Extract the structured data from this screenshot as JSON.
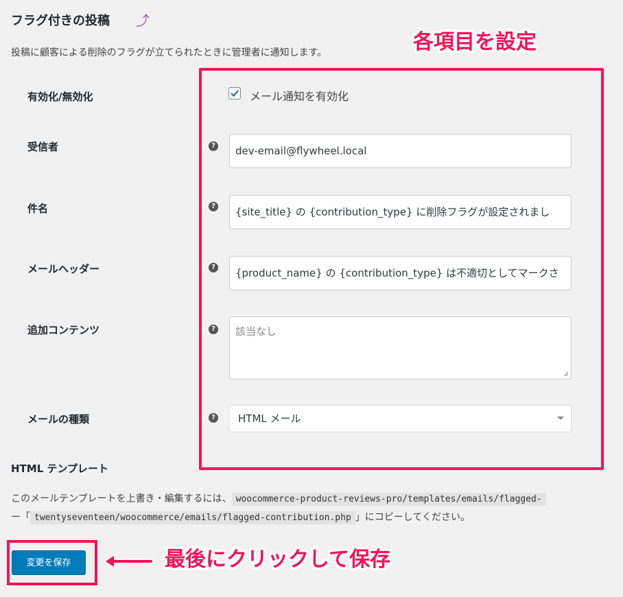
{
  "page": {
    "title": "フラグ付きの投稿",
    "back_link": "⤴",
    "description": "投稿に顧客による削除のフラグが立てられたときに管理者に通知します。"
  },
  "form": {
    "enable": {
      "label": "有効化/無効化",
      "checkbox_label": "メール通知を有効化",
      "checked": true
    },
    "recipient": {
      "label": "受信者",
      "value": "dev-email@flywheel.local"
    },
    "subject": {
      "label": "件名",
      "value": "{site_title} の {contribution_type} に削除フラグが設定されまし"
    },
    "header": {
      "label": "メールヘッダー",
      "value": "{product_name} の {contribution_type} は不適切としてマークさ"
    },
    "additional": {
      "label": "追加コンテンツ",
      "placeholder": "該当なし"
    },
    "email_type": {
      "label": "メールの種類",
      "selected": "HTML メール"
    },
    "help_icon": "?"
  },
  "template": {
    "heading": "HTML テンプレート",
    "line1_prefix": "このメールテンプレートを上書き・編集するには、",
    "line1_code": "woocommerce-product-reviews-pro/templates/emails/flagged-",
    "line2_prefix": "ー「",
    "line2_code": "twentyseventeen/woocommerce/emails/flagged-contribution.php",
    "line2_suffix": "」にコピーしてください。"
  },
  "actions": {
    "save_label": "変更を保存"
  },
  "annotations": {
    "top": "各項目を設定",
    "bottom": "最後にクリックして保存",
    "color": "#f0145a"
  }
}
